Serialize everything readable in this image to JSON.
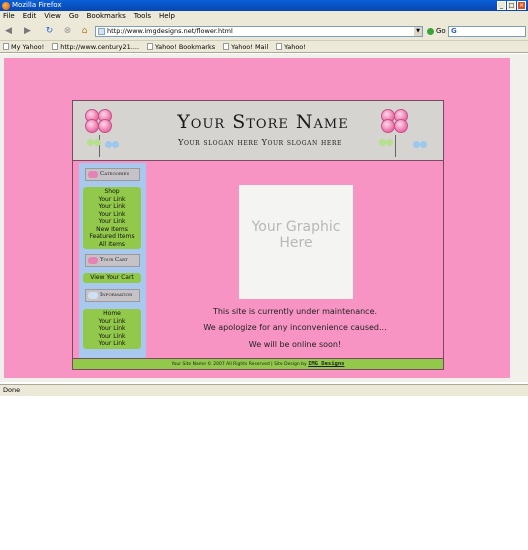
{
  "window": {
    "title": "Mozilla Firefox",
    "controls": [
      "_",
      "□",
      "×"
    ]
  },
  "menu": [
    "File",
    "Edit",
    "View",
    "Go",
    "Bookmarks",
    "Tools",
    "Help"
  ],
  "toolbar": {
    "url": "http://www.imgdesigns.net/flower.html",
    "go_label": "Go",
    "search_engine": "G"
  },
  "bookmarks": [
    "My Yahoo!",
    "http://www.century21....",
    "Yahoo! Bookmarks",
    "Yahoo! Mail",
    "Yahoo!"
  ],
  "store": {
    "name": "Your Store Name",
    "slogan": "Your slogan here Your slogan here",
    "sidebar": {
      "categories_title": "Categories",
      "categories": [
        "Shop",
        "Your Link",
        "Your Link",
        "Your Link",
        "Your Link",
        "New Items",
        "Featured Items",
        "All Items"
      ],
      "cart_title": "Your Cart",
      "cart_link": "View Your Cart",
      "info_title": "Information",
      "info_links": [
        "Home",
        "Your Link",
        "Your Link",
        "Your Link",
        "Your Link"
      ]
    },
    "graphic_placeholder": "Your Graphic Here",
    "messages": [
      "This site is currently under maintenance.",
      "We apologize for any inconvenience caused...",
      "We will be online soon!"
    ],
    "footer_text": "Your Site Name © 2007 All Rights Reserved  |  Site Design by",
    "footer_brand": "IMG Designs"
  },
  "status": "Done",
  "colors": {
    "page_bg": "#f794c4",
    "header_bg": "#d6d4d1",
    "sidebar_bg": "#a9c8ee",
    "link_box": "#92c94a"
  }
}
